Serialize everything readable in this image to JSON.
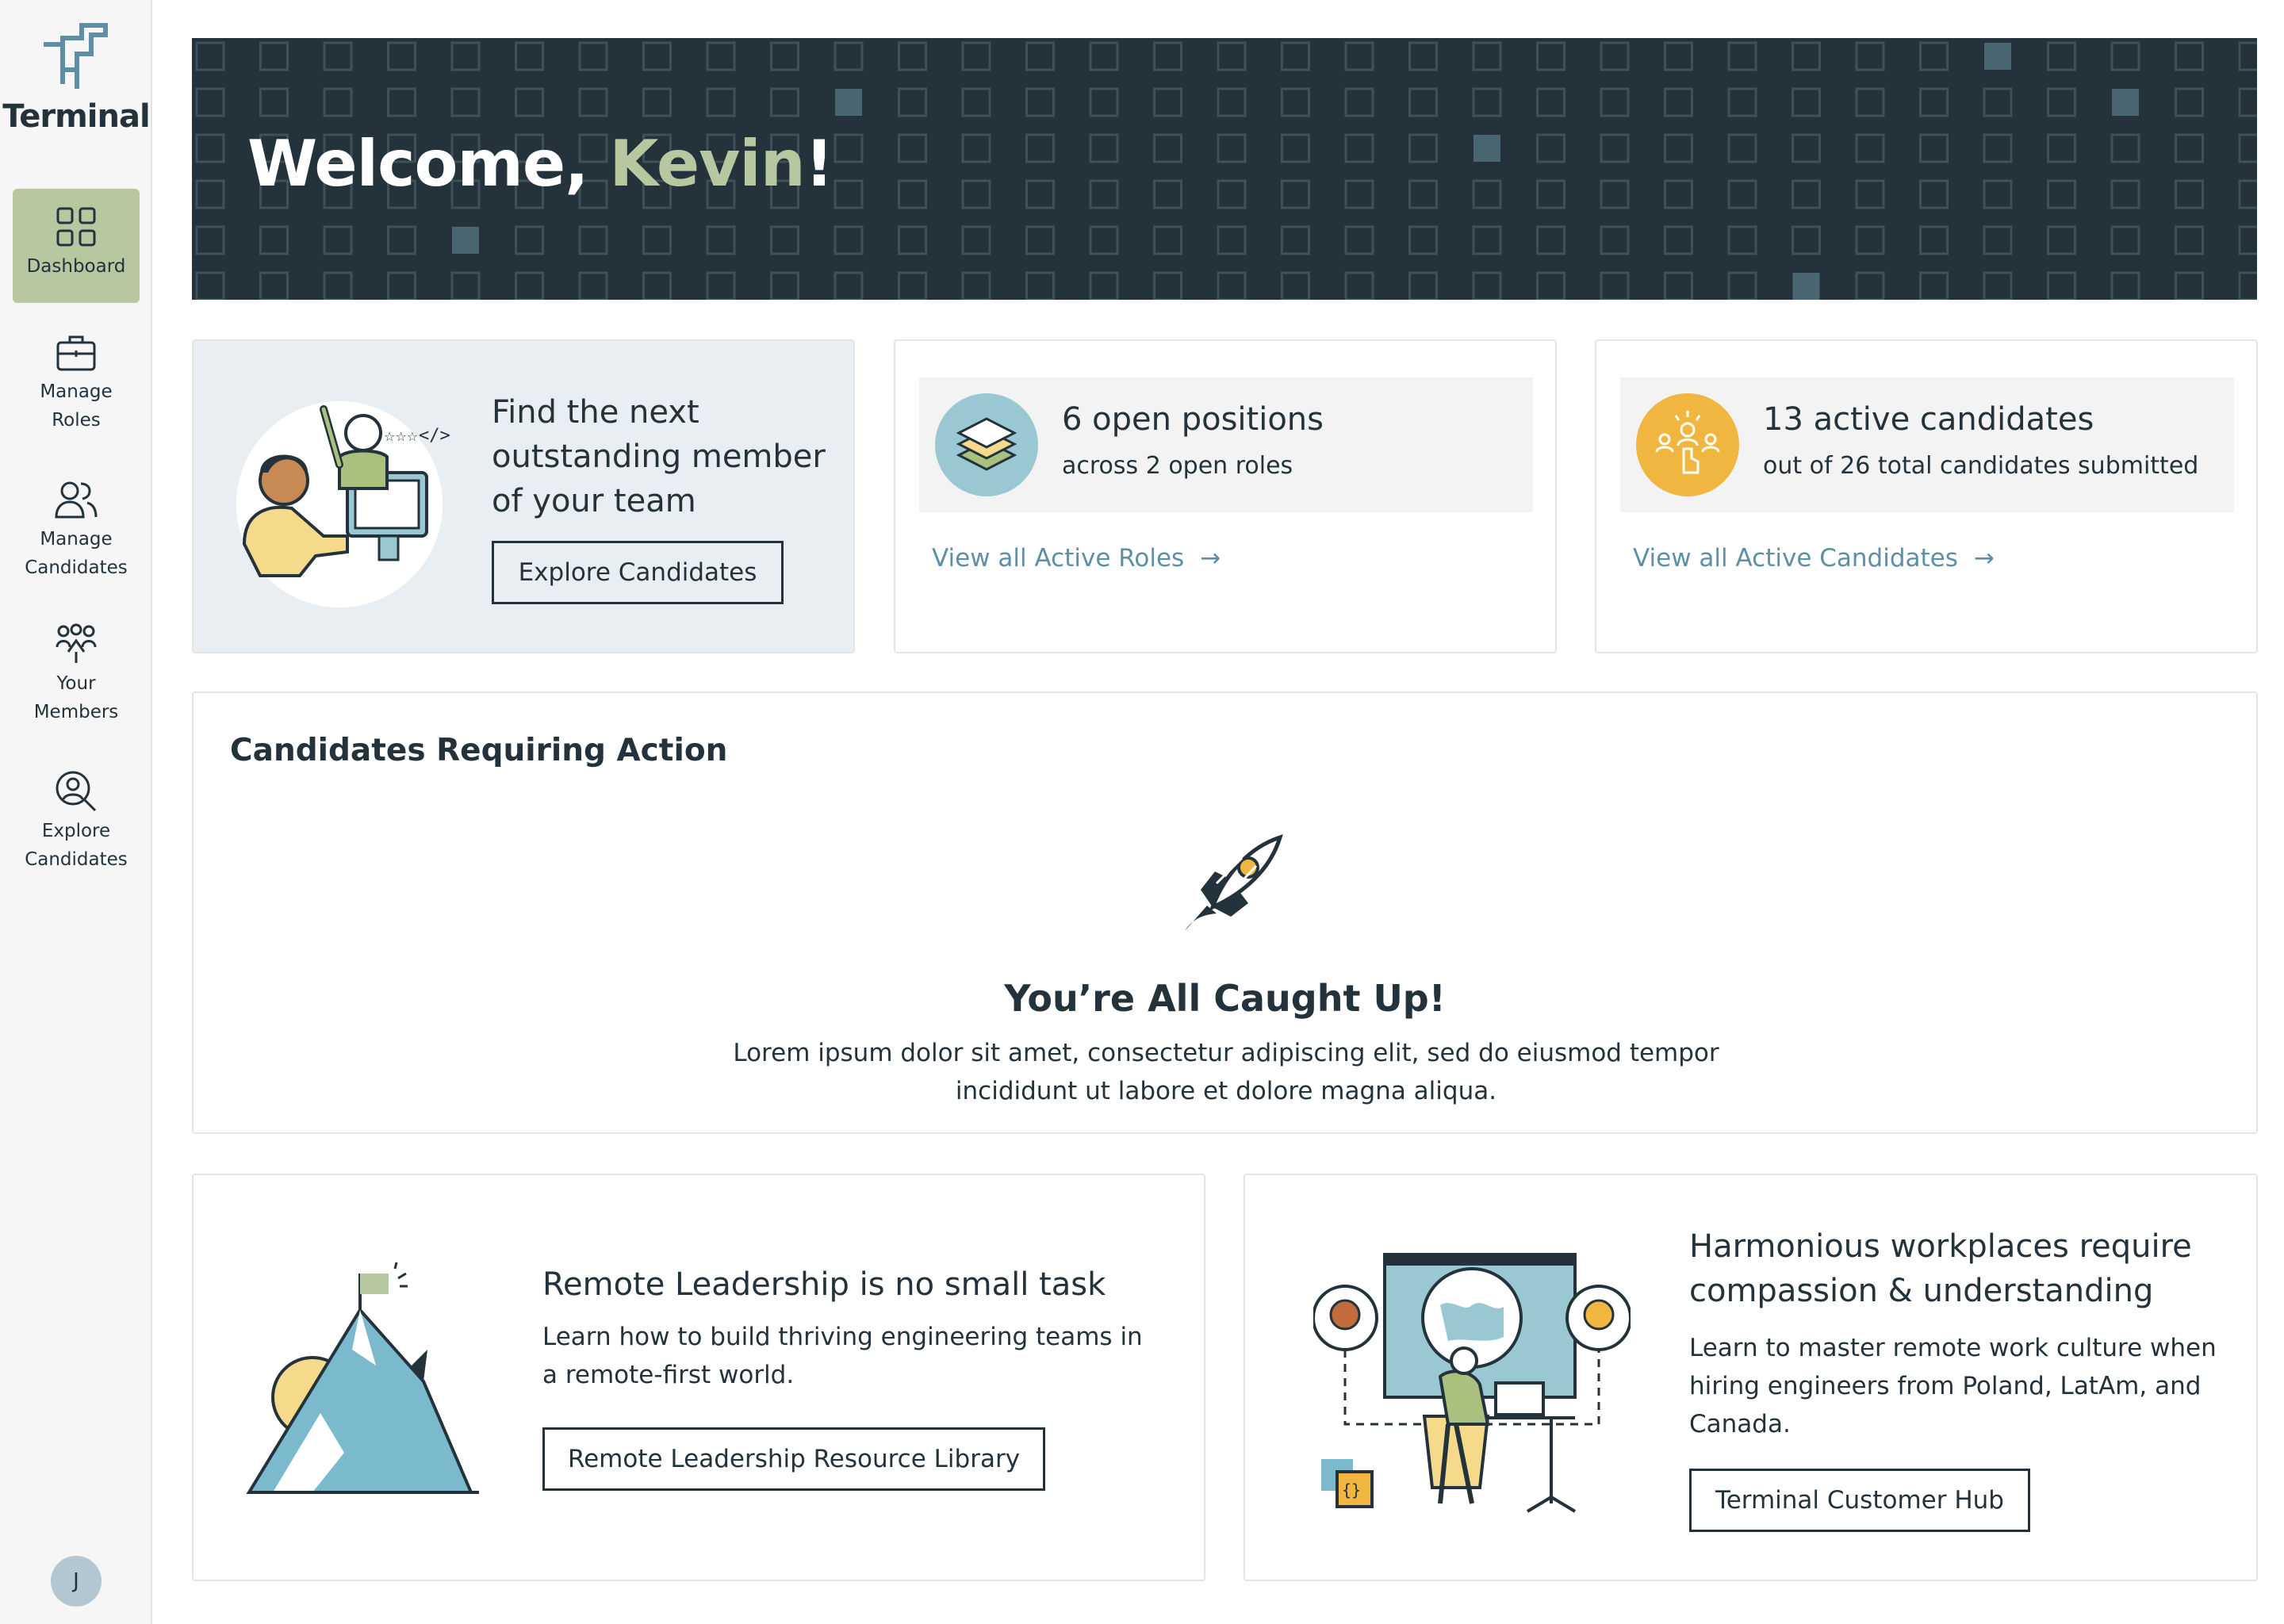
{
  "app": {
    "logo_text": "Terminal",
    "avatar_initial": "J"
  },
  "sidebar": {
    "items": [
      {
        "label": "Dashboard",
        "icon": "dashboard-icon",
        "active": true
      },
      {
        "label": "Manage\nRoles",
        "icon": "briefcase-icon",
        "active": false
      },
      {
        "label": "Manage\nCandidates",
        "icon": "users-icon",
        "active": false
      },
      {
        "label": "Your\nMembers",
        "icon": "members-icon",
        "active": false
      },
      {
        "label": "Explore\nCandidates",
        "icon": "search-user-icon",
        "active": false
      }
    ]
  },
  "banner": {
    "greeting": "Welcome, ",
    "name": "Kevin",
    "punct": "!"
  },
  "find_card": {
    "text": "Find the next outstanding member of your team",
    "button": "Explore Candidates"
  },
  "roles_card": {
    "title": "6 open positions",
    "subtitle": "across 2 open roles",
    "link": "View all Active Roles",
    "icon": "layers-icon"
  },
  "candidates_card": {
    "title": "13 active candidates",
    "subtitle": "out of 26 total candidates submitted",
    "link": "View all Active Candidates",
    "icon": "selection-icon"
  },
  "action": {
    "title": "Candidates Requiring Action",
    "empty_title": "You’re All Caught Up!",
    "empty_desc": "Lorem ipsum dolor sit amet, consectetur adipiscing elit, sed do eiusmod tempor incididunt ut labore et dolore magna aliqua."
  },
  "resource_1": {
    "title": "Remote Leadership is no small task",
    "desc": "Learn how to build thriving engineering teams in a remote-first world.",
    "button": "Remote Leadership Resource Library"
  },
  "resource_2": {
    "title": "Harmonious workplaces require compassion & understanding",
    "desc": "Learn to master remote work culture when hiring engineers from Poland, LatAm, and Canada.",
    "button": "Terminal Customer Hub"
  },
  "colors": {
    "dark": "#23323b",
    "accent_green": "#b7c7a0",
    "link_blue": "#5f8fa5",
    "teal_circle": "#9ac8d2",
    "yellow_circle": "#f0b63f"
  }
}
